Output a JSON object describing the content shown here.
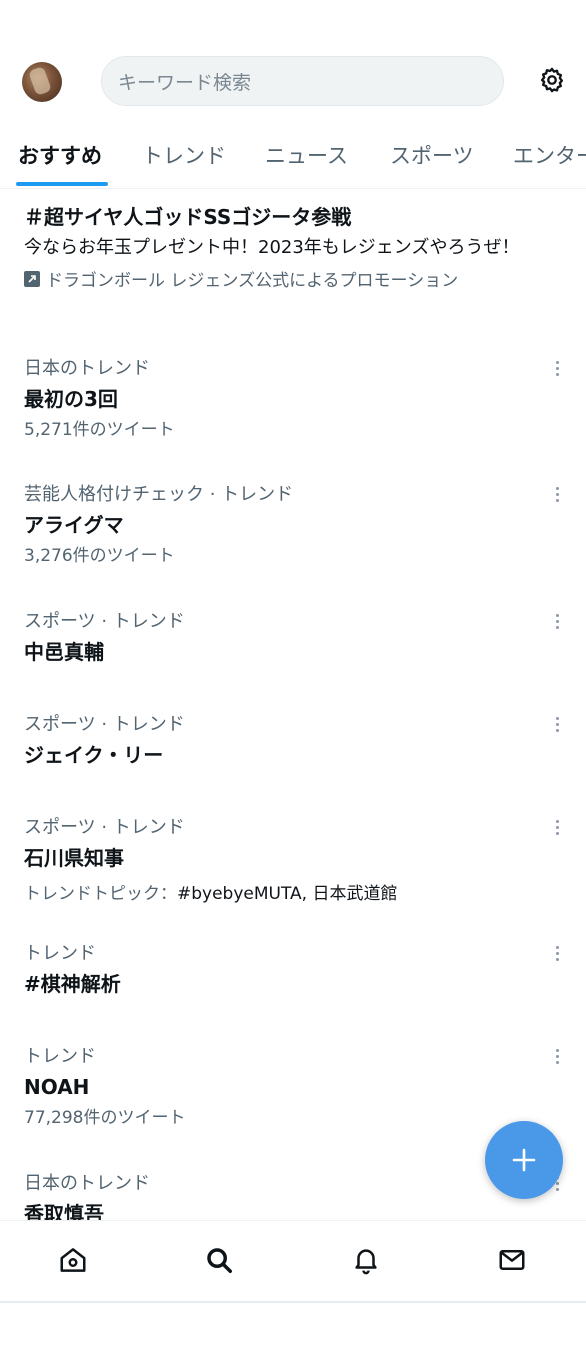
{
  "search": {
    "placeholder": "キーワード検索"
  },
  "tabs": [
    {
      "label": "おすすめ",
      "active": true
    },
    {
      "label": "トレンド",
      "active": false
    },
    {
      "label": "ニュース",
      "active": false
    },
    {
      "label": "スポーツ",
      "active": false
    },
    {
      "label": "エンター",
      "active": false
    }
  ],
  "promoted": {
    "title": "＃超サイヤ人ゴッドSSゴジータ参戦",
    "body": "今ならお年玉プレゼント中！2023年もレジェンズやろうぜ！",
    "promoted_by": "ドラゴンボール レジェンズ公式によるプロモーション"
  },
  "trends": [
    {
      "context": "日本のトレンド",
      "name": "最初の3回",
      "count": "5,271件のツイート"
    },
    {
      "context": "芸能人格付けチェック · トレンド",
      "name": "アライグマ",
      "count": "3,276件のツイート"
    },
    {
      "context": "スポーツ · トレンド",
      "name": "中邑真輔"
    },
    {
      "context": "スポーツ · トレンド",
      "name": "ジェイク・リー"
    },
    {
      "context": "スポーツ · トレンド",
      "name": "石川県知事",
      "topic_label": "トレンドトピック：",
      "topic_values": "#byebyeMUTA, 日本武道館"
    },
    {
      "context": "トレンド",
      "name": "#棋神解析"
    },
    {
      "context": "トレンド",
      "name": "NOAH",
      "count": "77,298件のツイート"
    },
    {
      "context": "日本のトレンド",
      "name": "香取慎吾"
    }
  ],
  "fab": {
    "icon": "plus-icon"
  },
  "bottom_nav": [
    {
      "icon": "home-icon"
    },
    {
      "icon": "search-icon",
      "active": true
    },
    {
      "icon": "bell-icon"
    },
    {
      "icon": "mail-icon"
    }
  ],
  "colors": {
    "accent": "#1d9bf0",
    "fab": "#4a99e9",
    "secondary_text": "#536471"
  }
}
